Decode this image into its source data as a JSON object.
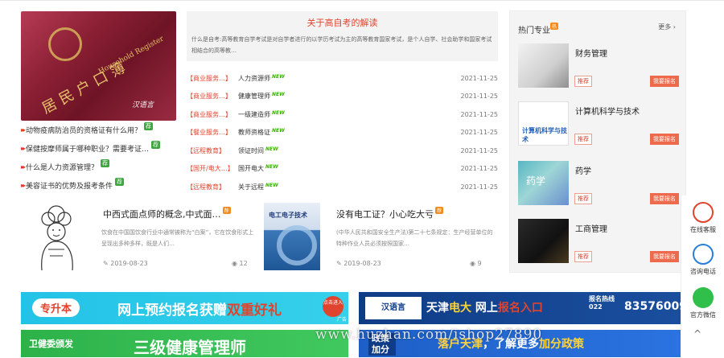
{
  "left_links": [
    "动物疫病防治员的资格证有什么用？",
    "保健按摩师属于哪种职业？需要考证…",
    "什么是人力资源管理？",
    "美容证书的优势及报考条件"
  ],
  "left_tag": "荐",
  "photo": {
    "title": "居民户口簿",
    "subtitle": "Household Register",
    "watermark": "汉语言"
  },
  "intro": {
    "title": "关于高自考的解读",
    "desc": "什么是自考:高等教育自学考试是对自学者进行的以学历考试为主的高等教育国家考试，是个人自学、社会助学和国家考试相结合的高等教…"
  },
  "news": [
    {
      "cat": "【商业服务…】",
      "title": "人力资源师",
      "date": "2021-11-25"
    },
    {
      "cat": "【商业服务…】",
      "title": "健康管理师",
      "date": "2021-11-25"
    },
    {
      "cat": "【商业服务…】",
      "title": "一级建造师",
      "date": "2021-11-25"
    },
    {
      "cat": "【餐业服务…】",
      "title": "教师资格证",
      "date": "2021-11-25"
    },
    {
      "cat": "【远程教育】",
      "title": "领证时间",
      "date": "2021-11-25"
    },
    {
      "cat": "【国开/电大…】",
      "title": "国开电大",
      "date": "2021-11-25"
    },
    {
      "cat": "【远程教育】",
      "title": "关于远程",
      "date": "2021-11-25"
    }
  ],
  "new_label": "NEW",
  "cards": [
    {
      "title": "中西式面点师的概念,中式面…",
      "desc": "饮食在中国国饮食行业中通常被称为“白案”，它在饮食形式上呈现出多种多样，既是人们…",
      "date": "2019-08-23",
      "views": "12",
      "badge": "荐"
    },
    {
      "title": "没有电工证？小心吃大亏",
      "desc": "(中华人民共和国安全生产法)第二十七条规定：生产经营单位的特种作业人员必须按照国家…",
      "date": "2019-08-23",
      "views": "9",
      "badge": "荐",
      "book_title": "电工电子技术"
    }
  ],
  "sidebar": {
    "header": "热门专业",
    "hot": "热",
    "more": "更多",
    "majors": [
      {
        "name": "财务管理",
        "rec": "推荐",
        "apply": "我要报名"
      },
      {
        "name": "计算机科学与技术",
        "rec": "推荐",
        "apply": "我要报名",
        "img_text": "计算机科学与技术"
      },
      {
        "name": "药学",
        "rec": "推荐",
        "apply": "我要报名",
        "img_text": "药学"
      },
      {
        "name": "工商管理",
        "rec": "推荐",
        "apply": "我要报名"
      }
    ]
  },
  "float": [
    {
      "label": "在线客服"
    },
    {
      "label": "咨询电话"
    },
    {
      "label": "官方微信"
    }
  ],
  "banners": {
    "b1_tag": "专升本",
    "b1_main": "网上预约报名获赠",
    "b1_hl": "双重好礼",
    "b1_btn": "点击进入",
    "b1_ad": "广告",
    "b2_logo": "汉语言",
    "b2_t1": "天津",
    "b2_t2": "电大",
    "b2_t3": "网上",
    "b2_t4": "报名入口",
    "b2_hot": "报名热线 022",
    "b2_phone": "83576009",
    "b3_a": "卫健委颁发",
    "b3_b": "三级健康管理师",
    "b4_a": "政策加分",
    "b4_b1": "落户天津",
    "b4_b2": "，了解更多",
    "b4_b3": "加分政策"
  },
  "watermark": "www.huzhan.com/ishop27890",
  "to_top": "^"
}
